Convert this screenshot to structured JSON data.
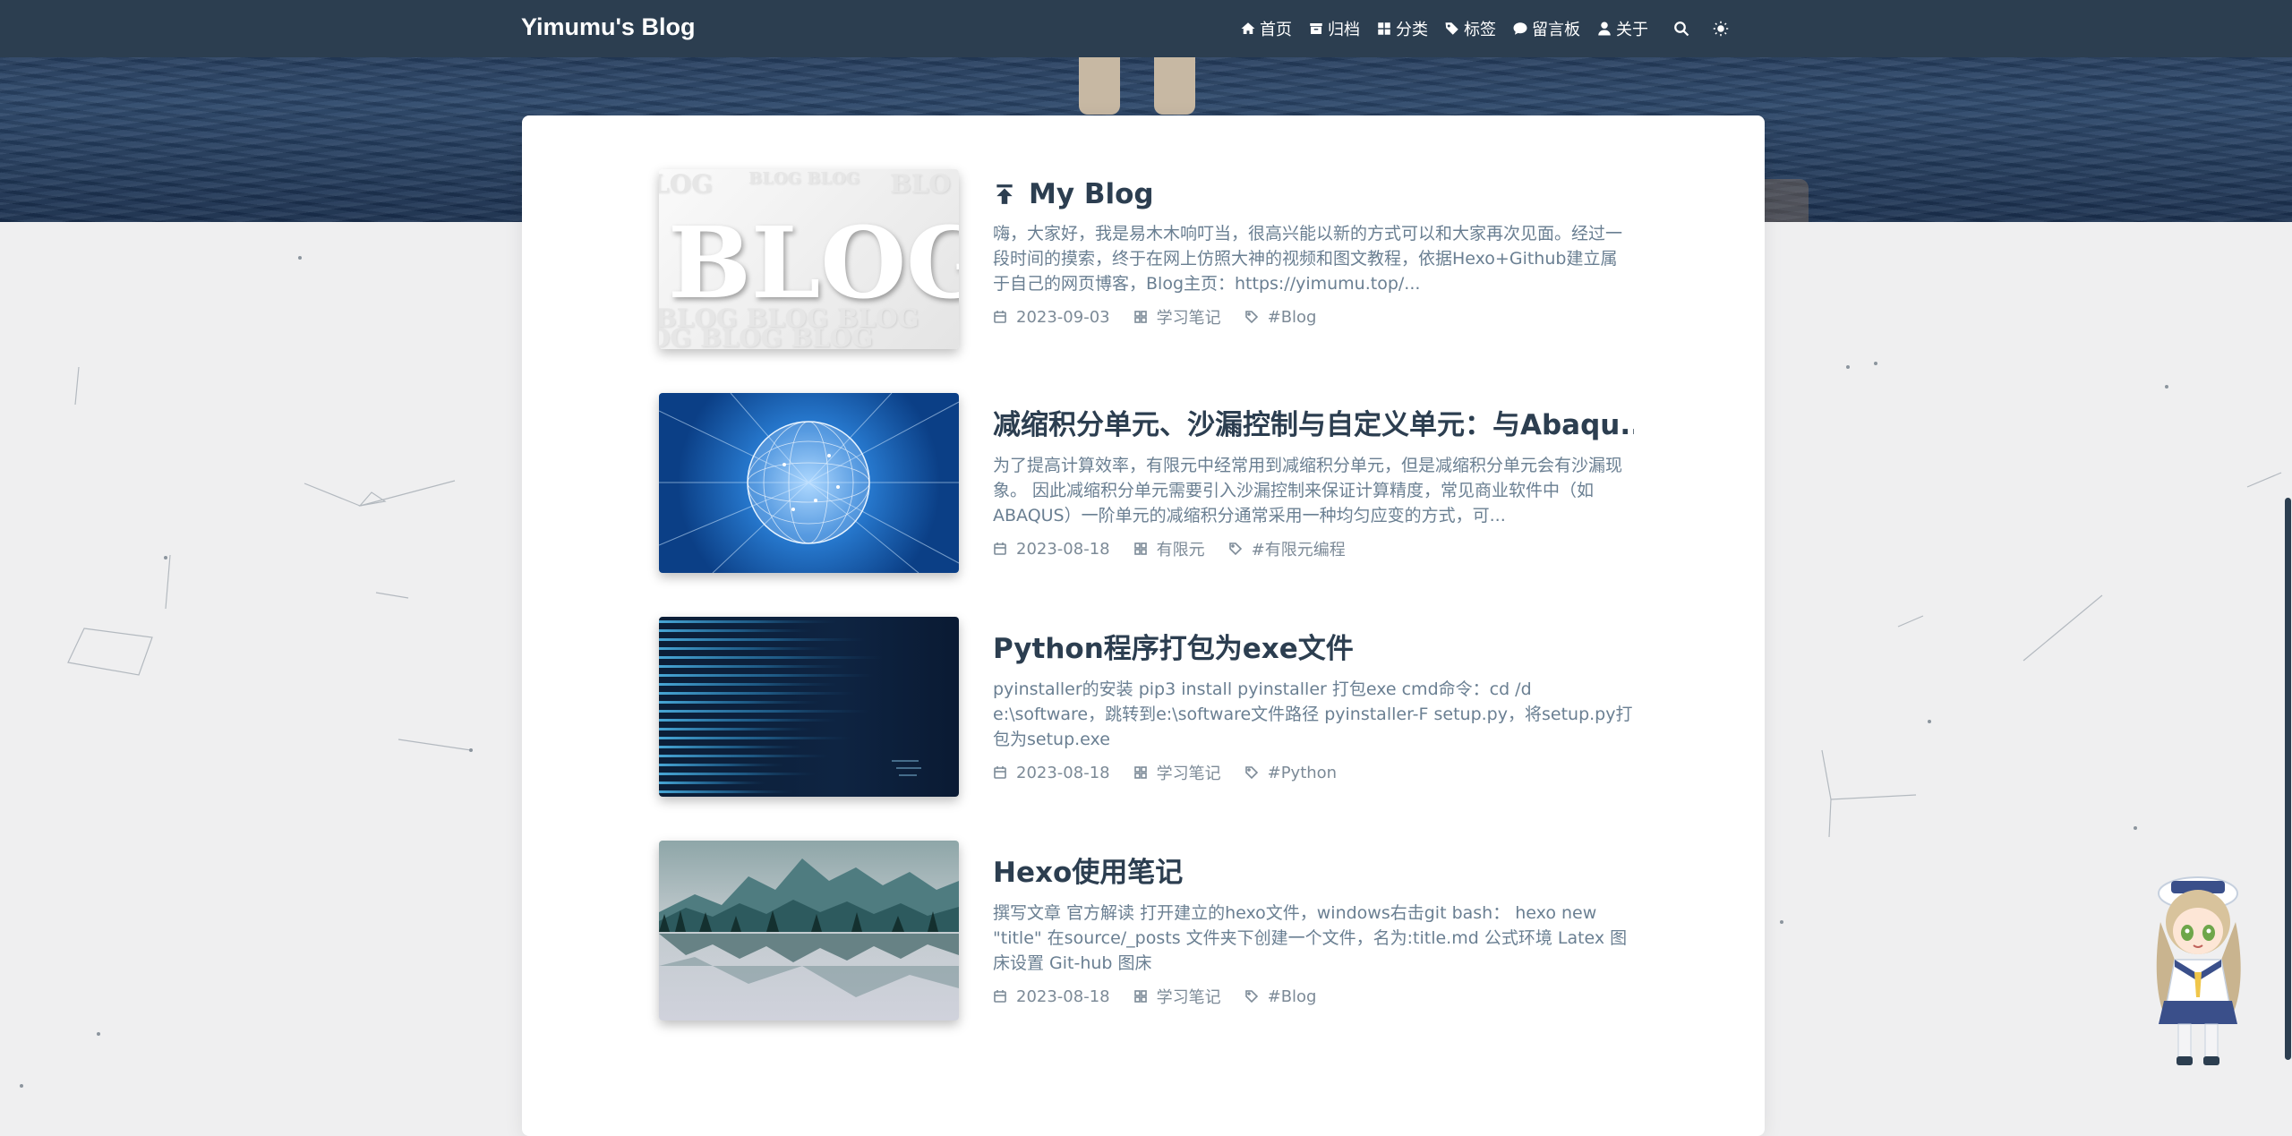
{
  "navbar": {
    "brand": "Yimumu's Blog",
    "items": [
      {
        "label": "首页",
        "icon": "home-icon"
      },
      {
        "label": "归档",
        "icon": "archive-icon"
      },
      {
        "label": "分类",
        "icon": "category-icon"
      },
      {
        "label": "标签",
        "icon": "tags-icon"
      },
      {
        "label": "留言板",
        "icon": "comment-icon"
      },
      {
        "label": "关于",
        "icon": "user-icon"
      }
    ],
    "search_icon": "search-icon",
    "theme_icon": "sun-icon"
  },
  "posts": [
    {
      "title": "My Blog",
      "pinned": true,
      "excerpt": "嗨，大家好，我是易木木响叮当，很高兴能以新的方式可以和大家再次见面。经过一段时间的摸索，终于在网上仿照大神的视频和图文教程，依据Hexo+Github建立属于自己的网页博客，Blog主页：https://yimumu.top/...",
      "date": "2023-09-03",
      "category": "学习笔记",
      "tag": "#Blog",
      "thumb_text": "BLOG"
    },
    {
      "title": "减缩积分单元、沙漏控制与自定义单元：与Abaqu...",
      "pinned": false,
      "excerpt": "为了提高计算效率，有限元中经常用到减缩积分单元，但是减缩积分单元会有沙漏现象。 因此减缩积分单元需要引入沙漏控制来保证计算精度，常见商业软件中（如ABAQUS）一阶单元的减缩积分通常采用一种均匀应变的方式，可...",
      "date": "2023-08-18",
      "category": "有限元",
      "tag": "#有限元编程"
    },
    {
      "title": "Python程序打包为exe文件",
      "pinned": false,
      "excerpt": "pyinstaller的安装 pip3 install pyinstaller 打包exe cmd命令：cd /d e:\\software，跳转到e:\\software文件路径 pyinstaller-F setup.py，将setup.py打包为setup.exe",
      "date": "2023-08-18",
      "category": "学习笔记",
      "tag": "#Python"
    },
    {
      "title": "Hexo使用笔记",
      "pinned": false,
      "excerpt": "撰写文章 官方解读 打开建立的hexo文件，windows右击git bash： hexo new \"title\" 在source/_posts 文件夹下创建一个文件，名为:title.md 公式环境 Latex 图床设置 Git-hub 图床",
      "date": "2023-08-18",
      "category": "学习笔记",
      "tag": "#Blog"
    }
  ]
}
